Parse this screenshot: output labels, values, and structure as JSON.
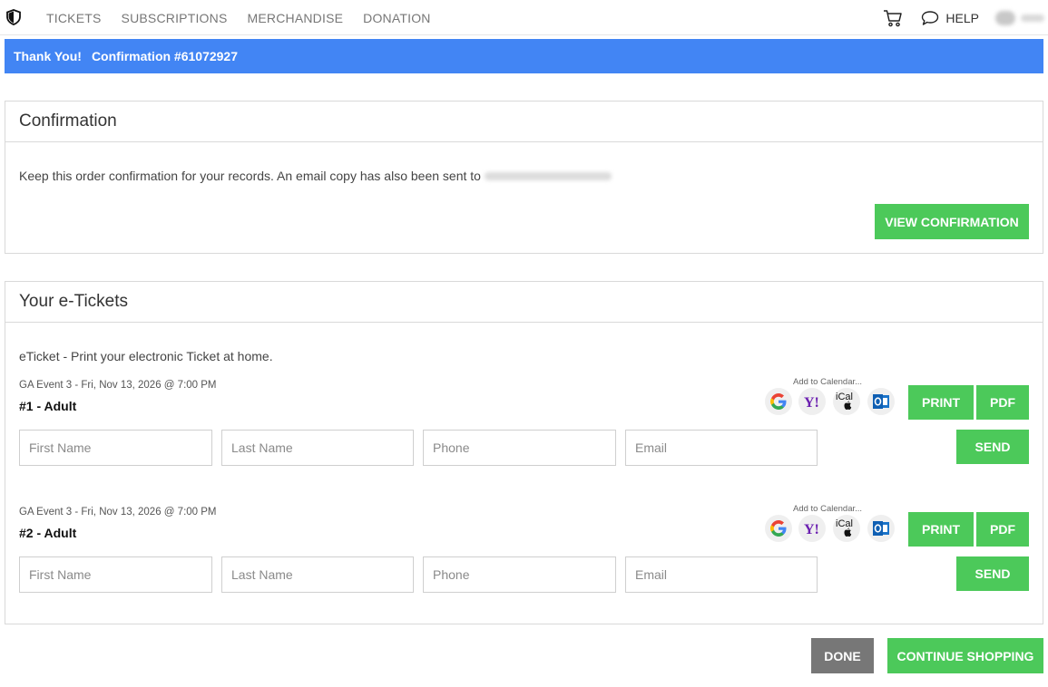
{
  "nav": {
    "links": [
      "TICKETS",
      "SUBSCRIPTIONS",
      "MERCHANDISE",
      "DONATION"
    ],
    "help_label": "HELP"
  },
  "banner": {
    "thanks": "Thank You!",
    "confirmation": "Confirmation #61072927"
  },
  "confirmation_panel": {
    "title": "Confirmation",
    "text": "Keep this order confirmation for your records. An email copy has also been sent to",
    "view_button": "VIEW CONFIRMATION"
  },
  "tickets_panel": {
    "title": "Your e-Tickets",
    "description": "eTicket - Print your electronic Ticket at home.",
    "tickets": [
      {
        "event": "GA Event 3 - Fri, Nov 13, 2026 @ 7:00 PM",
        "title": "#1 - Adult",
        "add_to_calendar": "Add to Calendar...",
        "print_label": "PRINT",
        "pdf_label": "PDF",
        "send_label": "SEND",
        "placeholders": {
          "first_name": "First Name",
          "last_name": "Last Name",
          "phone": "Phone",
          "email": "Email"
        }
      },
      {
        "event": "GA Event 3 - Fri, Nov 13, 2026 @ 7:00 PM",
        "title": "#2 - Adult",
        "add_to_calendar": "Add to Calendar...",
        "print_label": "PRINT",
        "pdf_label": "PDF",
        "send_label": "SEND",
        "placeholders": {
          "first_name": "First Name",
          "last_name": "Last Name",
          "phone": "Phone",
          "email": "Email"
        }
      }
    ],
    "calendar_icons": [
      "google-calendar-icon",
      "yahoo-calendar-icon",
      "ical-icon",
      "outlook-icon"
    ],
    "ical_label": "iCal"
  },
  "footer": {
    "done_label": "DONE",
    "continue_label": "CONTINUE SHOPPING"
  },
  "colors": {
    "banner": "#4285f4",
    "primary_button": "#4cc95a",
    "done_button": "#777777"
  }
}
